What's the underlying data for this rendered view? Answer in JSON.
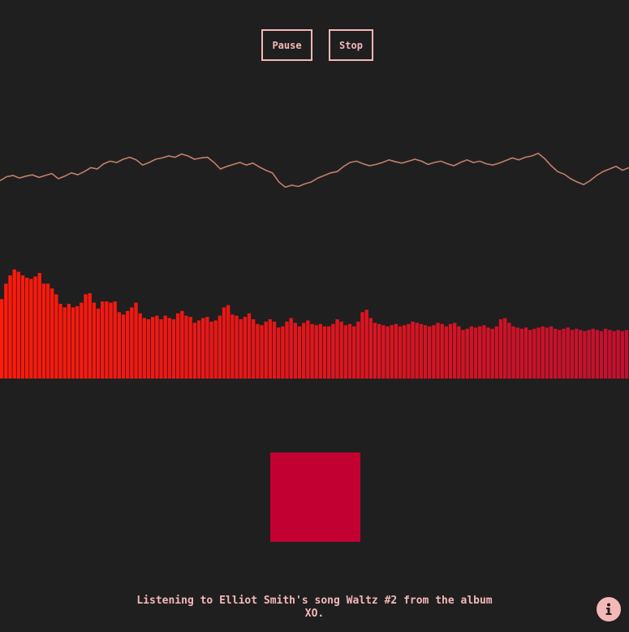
{
  "controls": {
    "pause_label": "Pause",
    "stop_label": "Stop"
  },
  "caption": {
    "text": "Listening to Elliot Smith's song Waltz #2 from the album XO."
  },
  "colors": {
    "background": "#1f1f1f",
    "accent": "#f4b8b8",
    "waveform": "#c47f6a",
    "bar_start": "#ff1a0a",
    "bar_end": "#c4102e",
    "square": "#c20032"
  },
  "icons": {
    "info": "info-icon"
  },
  "visualization": {
    "waveform_levels": [
      0.22,
      0.28,
      0.3,
      0.26,
      0.29,
      0.31,
      0.27,
      0.3,
      0.33,
      0.25,
      0.29,
      0.34,
      0.31,
      0.36,
      0.42,
      0.4,
      0.48,
      0.52,
      0.5,
      0.55,
      0.58,
      0.54,
      0.46,
      0.5,
      0.55,
      0.57,
      0.6,
      0.58,
      0.63,
      0.6,
      0.55,
      0.57,
      0.58,
      0.5,
      0.4,
      0.44,
      0.47,
      0.5,
      0.46,
      0.49,
      0.43,
      0.38,
      0.34,
      0.2,
      0.12,
      0.15,
      0.13,
      0.17,
      0.2,
      0.26,
      0.3,
      0.34,
      0.36,
      0.44,
      0.5,
      0.52,
      0.48,
      0.45,
      0.47,
      0.5,
      0.54,
      0.51,
      0.49,
      0.52,
      0.55,
      0.52,
      0.47,
      0.5,
      0.52,
      0.48,
      0.45,
      0.5,
      0.54,
      0.5,
      0.52,
      0.48,
      0.46,
      0.49,
      0.53,
      0.57,
      0.54,
      0.58,
      0.6,
      0.64,
      0.56,
      0.45,
      0.36,
      0.32,
      0.25,
      0.2,
      0.16,
      0.22,
      0.3,
      0.36,
      0.4,
      0.44,
      0.38,
      0.42
    ],
    "spectrum_levels": [
      0.67,
      0.8,
      0.87,
      0.92,
      0.9,
      0.87,
      0.85,
      0.84,
      0.86,
      0.89,
      0.8,
      0.8,
      0.76,
      0.71,
      0.63,
      0.6,
      0.63,
      0.6,
      0.61,
      0.64,
      0.71,
      0.72,
      0.64,
      0.59,
      0.65,
      0.65,
      0.64,
      0.65,
      0.56,
      0.54,
      0.57,
      0.6,
      0.64,
      0.55,
      0.51,
      0.5,
      0.52,
      0.53,
      0.5,
      0.53,
      0.51,
      0.5,
      0.55,
      0.57,
      0.53,
      0.52,
      0.47,
      0.49,
      0.51,
      0.52,
      0.48,
      0.49,
      0.53,
      0.6,
      0.62,
      0.54,
      0.53,
      0.5,
      0.52,
      0.55,
      0.5,
      0.46,
      0.45,
      0.48,
      0.5,
      0.48,
      0.43,
      0.44,
      0.48,
      0.51,
      0.47,
      0.44,
      0.47,
      0.49,
      0.46,
      0.45,
      0.46,
      0.44,
      0.44,
      0.46,
      0.5,
      0.48,
      0.45,
      0.46,
      0.44,
      0.48,
      0.56,
      0.58,
      0.51,
      0.47,
      0.46,
      0.45,
      0.44,
      0.45,
      0.46,
      0.44,
      0.45,
      0.46,
      0.48,
      0.47,
      0.46,
      0.45,
      0.44,
      0.45,
      0.47,
      0.46,
      0.44,
      0.46,
      0.47,
      0.44,
      0.41,
      0.42,
      0.44,
      0.43,
      0.44,
      0.45,
      0.43,
      0.42,
      0.44,
      0.5,
      0.51,
      0.47,
      0.44,
      0.43,
      0.42,
      0.43,
      0.41,
      0.42,
      0.43,
      0.44,
      0.43,
      0.44,
      0.42,
      0.41,
      0.42,
      0.43,
      0.41,
      0.42,
      0.41,
      0.4,
      0.41,
      0.42,
      0.41,
      0.4,
      0.42,
      0.41,
      0.4,
      0.41,
      0.4,
      0.41
    ],
    "pulse_level": 0.72
  }
}
